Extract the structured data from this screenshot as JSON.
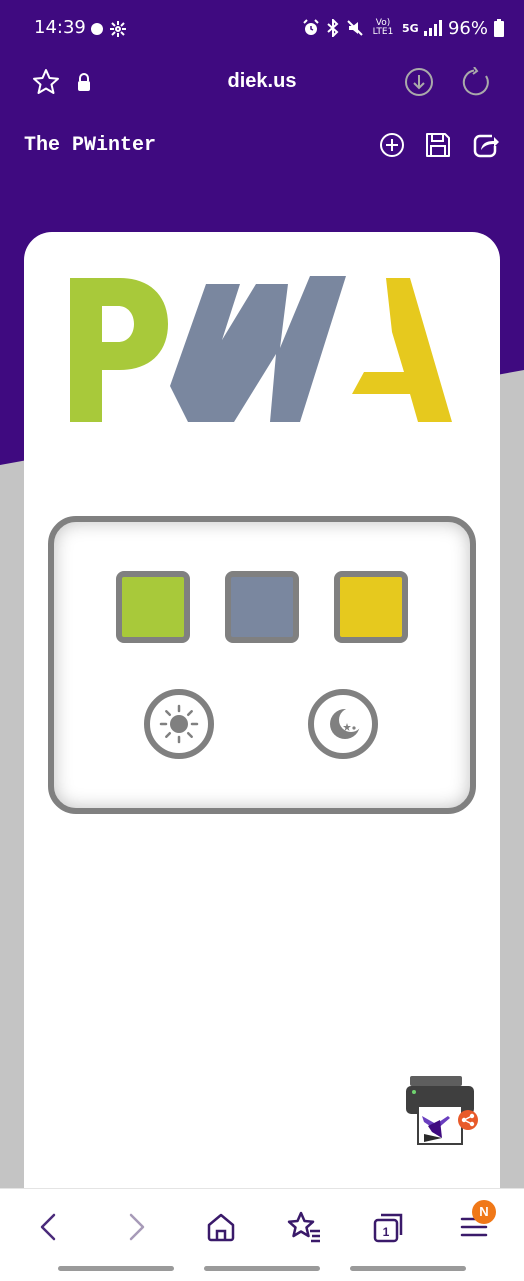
{
  "status_bar": {
    "time": "14:39",
    "network_label": "Vo) LTE1",
    "network_gen": "5G",
    "battery": "96%"
  },
  "browser": {
    "url": "diek.us",
    "menu_badge": "N"
  },
  "app": {
    "title": "The PWinter",
    "logo_letters": [
      "P",
      "W",
      "A"
    ],
    "colors": {
      "header_purple": "#3f0a80",
      "green": "#a8c93a",
      "slate": "#7a879f",
      "yellow": "#e6c91e",
      "gray_border": "#808080"
    },
    "swatches": [
      {
        "name": "green",
        "color": "#a8c93a"
      },
      {
        "name": "slate",
        "color": "#7a879f"
      },
      {
        "name": "yellow",
        "color": "#e6c91e"
      }
    ],
    "theme_buttons": [
      "light-mode",
      "dark-mode"
    ]
  }
}
